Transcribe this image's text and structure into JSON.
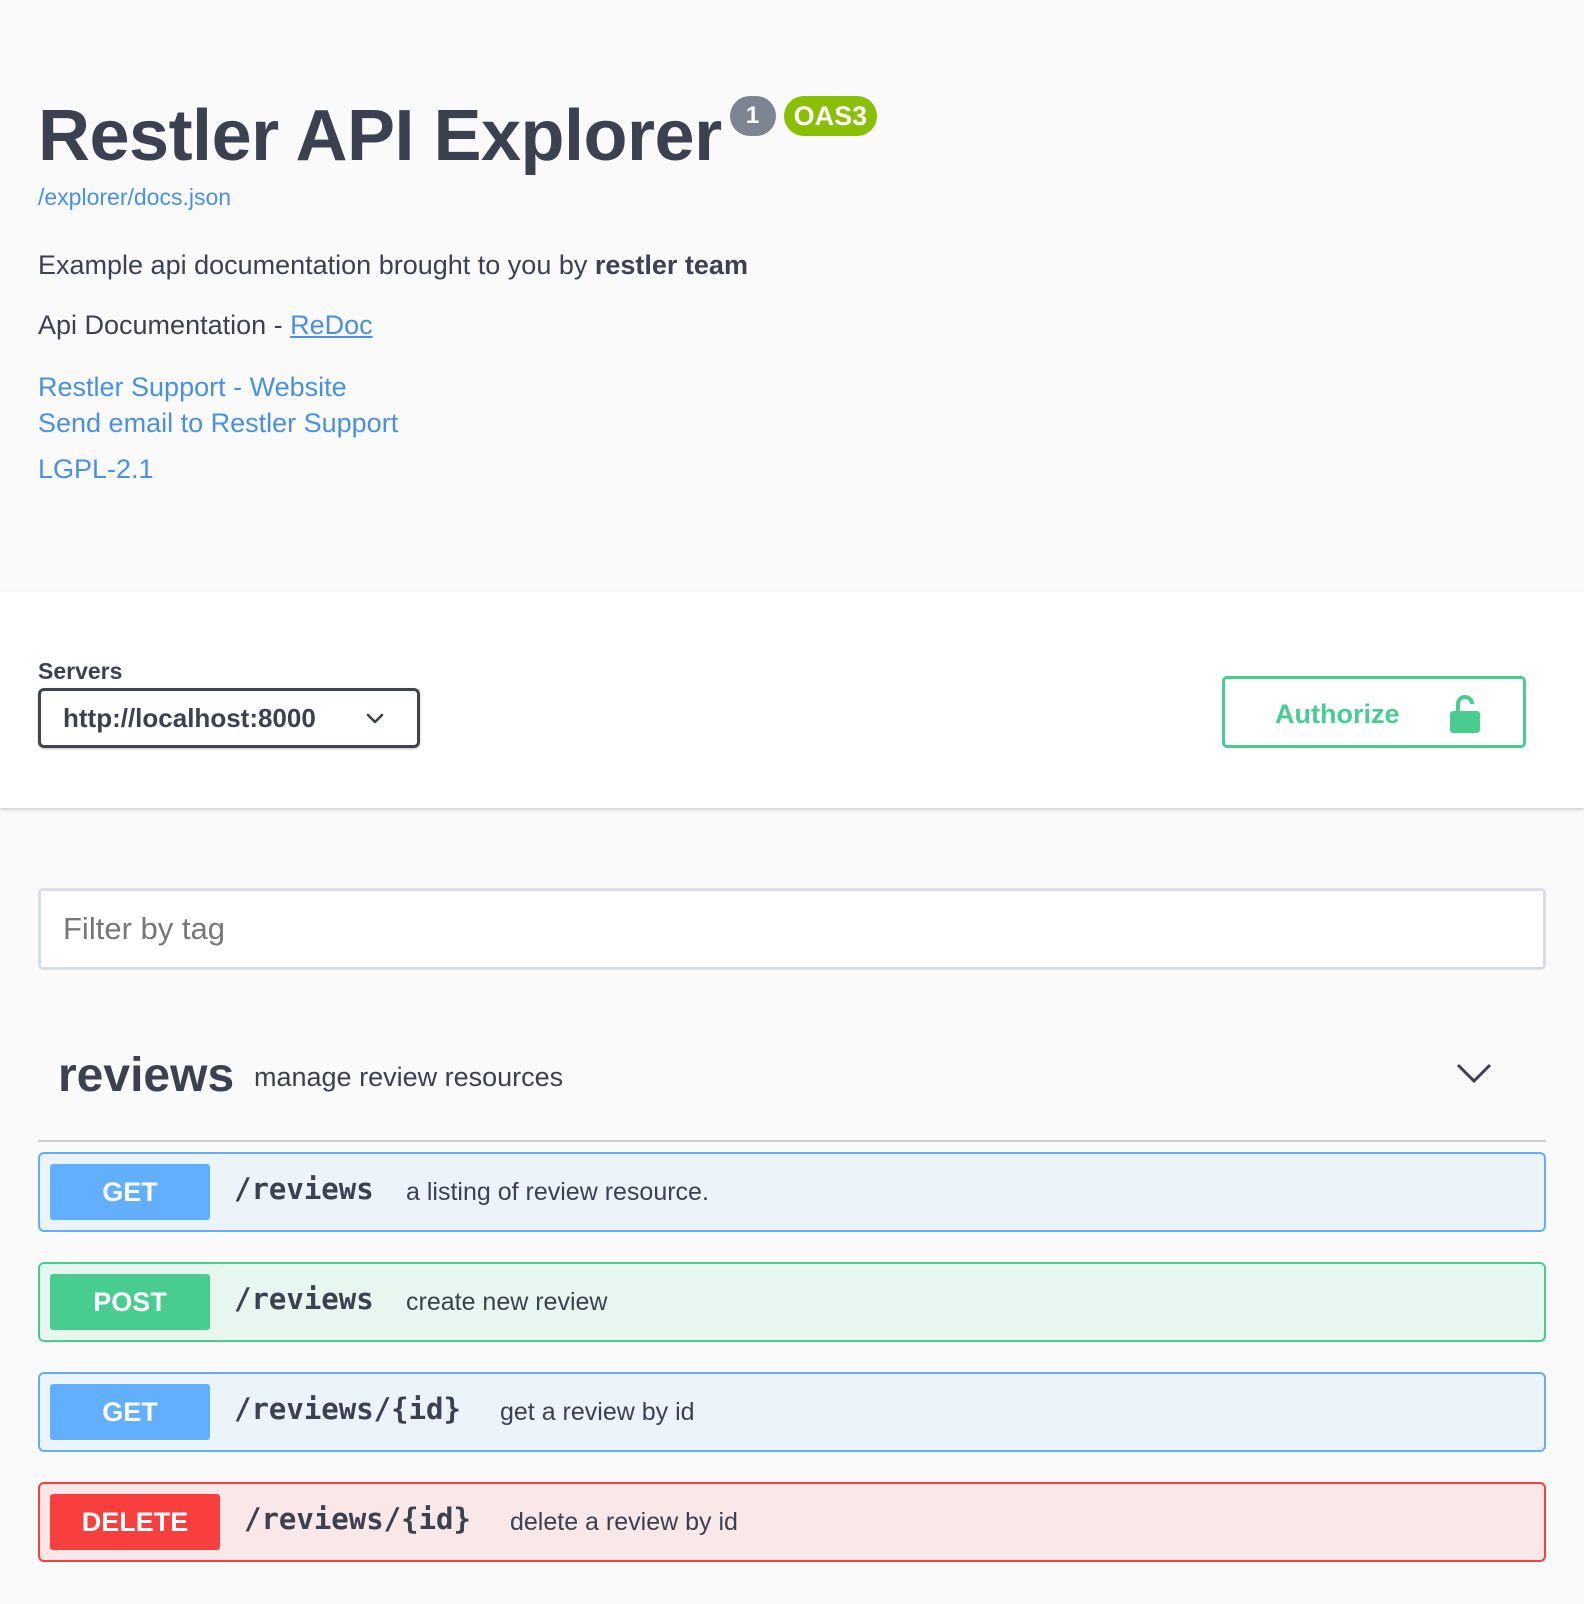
{
  "info": {
    "title": "Restler API Explorer",
    "version_badge": "1",
    "oas_badge": "OAS3",
    "spec_url": "/explorer/docs.json",
    "description_prefix": "Example api documentation brought to you by ",
    "description_bold": "restler team",
    "doc_prefix": "Api Documentation - ",
    "doc_link": "ReDoc",
    "support_website": "Restler Support - Website",
    "support_email": "Send email to Restler Support",
    "license": "LGPL-2.1"
  },
  "servers": {
    "label": "Servers",
    "selected": "http://localhost:8000"
  },
  "authorize": {
    "label": "Authorize"
  },
  "filter": {
    "placeholder": "Filter by tag"
  },
  "tag": {
    "name": "reviews",
    "description": "manage review resources"
  },
  "operations": [
    {
      "method": "GET",
      "path": "/reviews",
      "summary": "a listing of review resource."
    },
    {
      "method": "POST",
      "path": "/reviews",
      "summary": "create new review"
    },
    {
      "method": "GET",
      "path": "/reviews/{id}",
      "summary": "get a review by id"
    },
    {
      "method": "DELETE",
      "path": "/reviews/{id}",
      "summary": "delete a review by id"
    }
  ],
  "colors": {
    "get": "#61affe",
    "post": "#49cc90",
    "delete": "#f93e3e",
    "link": "#4990e2",
    "oas_badge": "#89bf04"
  }
}
